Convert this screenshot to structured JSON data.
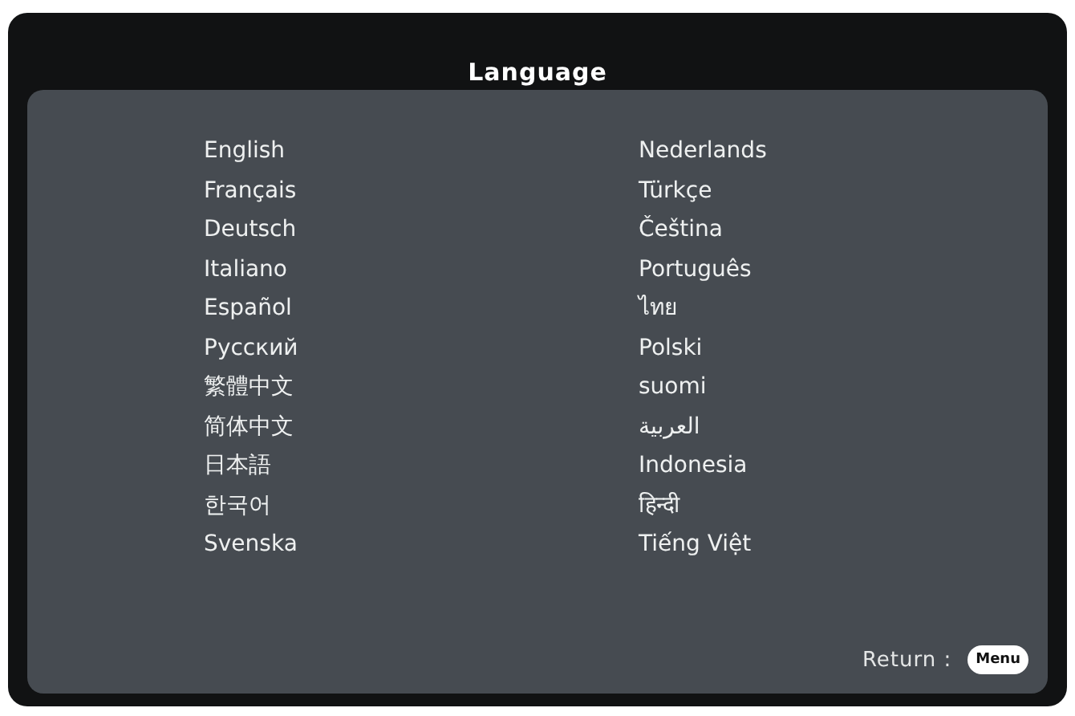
{
  "title": "Language",
  "columns": [
    {
      "languages": [
        "English",
        "Français",
        "Deutsch",
        "Italiano",
        "Español",
        "Русский",
        "繁體中文",
        "简体中文",
        "日本語",
        "한국어",
        "Svenska"
      ]
    },
    {
      "languages": [
        "Nederlands",
        "Türkçe",
        "Čeština",
        "Português",
        "ไทย",
        "Polski",
        "suomi",
        "العربية",
        "Indonesia",
        "हिन्दी",
        "Tiếng Việt"
      ]
    }
  ],
  "footer": {
    "label": "Return :",
    "key": "Menu"
  }
}
